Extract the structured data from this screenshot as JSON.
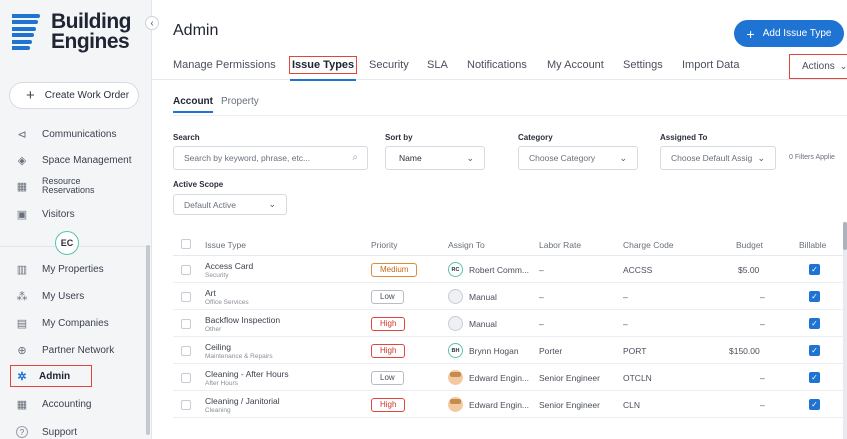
{
  "brand": {
    "line1": "Building",
    "line2": "Engines"
  },
  "sidebar": {
    "collapse_glyph": "‹",
    "create_label": "Create Work Order",
    "user_initials": "EC",
    "items": [
      {
        "label": "Communications",
        "icon": "megaphone-icon",
        "glyph": "⊲"
      },
      {
        "label": "Space Management",
        "icon": "layers-icon",
        "glyph": "◈"
      },
      {
        "label": "Resource Reservations",
        "icon": "calendar-icon",
        "glyph": "▦"
      },
      {
        "label": "Visitors",
        "icon": "badge-icon",
        "glyph": "▣"
      },
      {
        "label": "My Properties",
        "icon": "building-icon",
        "glyph": "▥"
      },
      {
        "label": "My Users",
        "icon": "users-icon",
        "glyph": "⁂"
      },
      {
        "label": "My Companies",
        "icon": "company-icon",
        "glyph": "▤"
      },
      {
        "label": "Partner Network",
        "icon": "globe-icon",
        "glyph": "⊕"
      },
      {
        "label": "Admin",
        "icon": "gear-icon",
        "glyph": "✲"
      },
      {
        "label": "Accounting",
        "icon": "calculator-icon",
        "glyph": "▦"
      },
      {
        "label": "Support",
        "icon": "help-icon",
        "glyph": "?"
      }
    ]
  },
  "header": {
    "title": "Admin",
    "add_button": "Add Issue Type",
    "tabs": [
      "Manage Permissions",
      "Issue Types",
      "Security",
      "SLA",
      "Notifications",
      "My Account",
      "Settings",
      "Import Data"
    ],
    "actions": "Actions"
  },
  "subtabs": [
    "Account",
    "Property"
  ],
  "filters": {
    "search_label": "Search",
    "search_placeholder": "Search by keyword, phrase, etc...",
    "sort_label": "Sort by",
    "sort_value": "Name",
    "category_label": "Category",
    "category_value": "Choose Category",
    "assigned_label": "Assigned To",
    "assigned_value": "Choose Default Assig",
    "filters_applied": "0 Filters Applie",
    "scope_label": "Active Scope",
    "scope_value": "Default Active"
  },
  "table": {
    "columns": [
      "Issue Type",
      "Priority",
      "Assign To",
      "Labor Rate",
      "Charge Code",
      "Budget",
      "Billable"
    ],
    "rows": [
      {
        "name": "Access Card",
        "category": "Security",
        "priority": "Medium",
        "avatar": "RC",
        "assignee": "Robert Comm...",
        "labor": "–",
        "code": "ACCSS",
        "budget": "$5.00",
        "billable": "✓"
      },
      {
        "name": "Art",
        "category": "Office Services",
        "priority": "Low",
        "avatar": "",
        "assignee": "Manual",
        "labor": "–",
        "code": "–",
        "budget": "–",
        "billable": "✓"
      },
      {
        "name": "Backflow Inspection",
        "category": "Other",
        "priority": "High",
        "avatar": "",
        "assignee": "Manual",
        "labor": "–",
        "code": "–",
        "budget": "–",
        "billable": "✓"
      },
      {
        "name": "Ceiling",
        "category": "Maintenance & Repairs",
        "priority": "High",
        "avatar": "BH",
        "assignee": "Brynn Hogan",
        "labor": "Porter",
        "code": "PORT",
        "budget": "$150.00",
        "billable": "✓"
      },
      {
        "name": "Cleaning - After Hours",
        "category": "After Hours",
        "priority": "Low",
        "avatar": "",
        "assignee": "Edward Engin...",
        "labor": "Senior Engineer",
        "code": "OTCLN",
        "budget": "–",
        "billable": "✓"
      },
      {
        "name": "Cleaning / Janitorial",
        "category": "Cleaning",
        "priority": "High",
        "avatar": "",
        "assignee": "Edward Engin...",
        "labor": "Senior Engineer",
        "code": "CLN",
        "budget": "–",
        "billable": "✓"
      }
    ]
  },
  "colors": {
    "accent": "#1f73d3",
    "highlight": "#e0463c",
    "avatar_ring": "#5cc1a8"
  }
}
